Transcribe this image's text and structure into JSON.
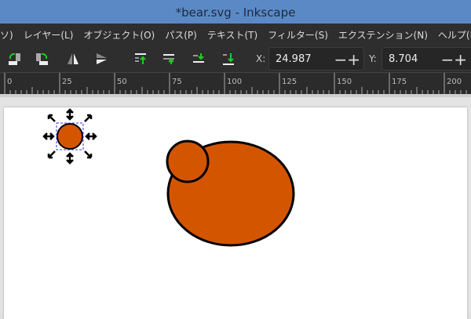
{
  "window": {
    "title": "*bear.svg - Inkscape"
  },
  "menu": [
    "ソ)",
    "レイヤー(L)",
    "オブジェクト(O)",
    "パス(P)",
    "テキスト(T)",
    "フィルター(S)",
    "エクステンション(N)",
    "ヘルプ(H)"
  ],
  "toolbar": {
    "x_label": "X:",
    "x_value": "24.987",
    "y_label": "Y:",
    "y_value": "8.704",
    "buttons": [
      "rotate-ccw",
      "rotate-cw",
      "flip-horizontal",
      "flip-vertical",
      "raise-to-top",
      "raise",
      "lower",
      "lower-to-bottom"
    ]
  },
  "ruler": {
    "labels": [
      "0",
      "25",
      "50",
      "75",
      "100",
      "125",
      "150",
      "175",
      "200"
    ]
  },
  "canvas": {
    "fill_color": "#d45500",
    "stroke_color": "#000000",
    "selection_color": "#3333ff"
  }
}
